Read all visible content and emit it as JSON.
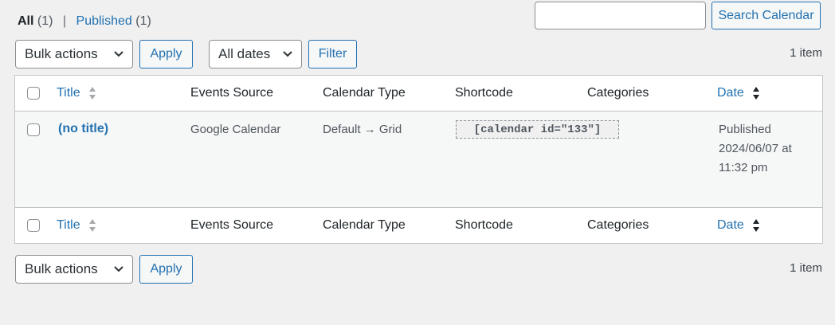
{
  "views": {
    "all_label": "All",
    "all_count": "(1)",
    "separator": "|",
    "published_label": "Published",
    "published_count": "(1)"
  },
  "search": {
    "value": "",
    "button_label": "Search Calendar"
  },
  "tablenav_top": {
    "bulk_actions": "Bulk actions",
    "apply": "Apply",
    "dates": "All dates",
    "filter": "Filter",
    "items": "1 item"
  },
  "table": {
    "columns": {
      "title": "Title",
      "events_source": "Events Source",
      "calendar_type": "Calendar Type",
      "shortcode": "Shortcode",
      "categories": "Categories",
      "date": "Date"
    },
    "rows": [
      {
        "title": "(no title)",
        "events_source": "Google Calendar",
        "calendar_type": "Default → Grid",
        "shortcode": "[calendar id=\"133\"]",
        "categories": "",
        "date_status": "Published",
        "date_line1": "2024/06/07 at",
        "date_line2": "11:32 pm"
      }
    ]
  },
  "tablenav_bottom": {
    "bulk_actions": "Bulk actions",
    "apply": "Apply",
    "items": "1 item"
  },
  "colors": {
    "link": "#2271b1",
    "background": "#f0f0f1",
    "row_background": "#f6f7f7"
  }
}
